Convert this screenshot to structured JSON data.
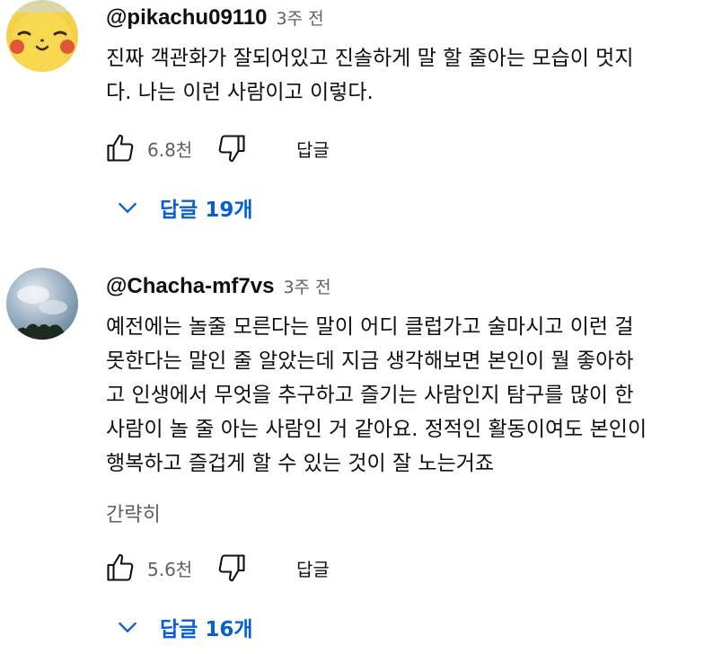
{
  "comments": [
    {
      "author": "@pikachu09110",
      "time": "3주 전",
      "text": "진짜 객관화가 잘되어있고 진솔하게 말 할 줄아는 모습이 멋지\n다. 나는 이런 사람이고 이렇다.",
      "likes": "6.8천",
      "reply_label": "답글",
      "replies_label": "답글 19개",
      "avatar_icon": "pikachu-avatar-icon"
    },
    {
      "author": "@Chacha-mf7vs",
      "time": "3주 전",
      "text": "예전에는 놀줄 모른다는 말이 어디 클럽가고 술마시고 이런 걸\n못한다는 말인 줄 알았는데 지금 생각해보면 본인이 뭘 좋아하\n고 인생에서 무엇을 추구하고 즐기는 사람인지 탐구를 많이 한\n사람이 놀 줄 아는 사람인 거 같아요. 정적인 활동이여도 본인이\n행복하고 즐겁게 할 수 있는 것이 잘 노는거죠",
      "more_label": "간략히",
      "likes": "5.6천",
      "reply_label": "답글",
      "replies_label": "답글 16개",
      "avatar_icon": "sky-avatar-icon"
    }
  ],
  "colors": {
    "text": "#0f0f0f",
    "secondary": "#606060",
    "link": "#065fd4"
  }
}
